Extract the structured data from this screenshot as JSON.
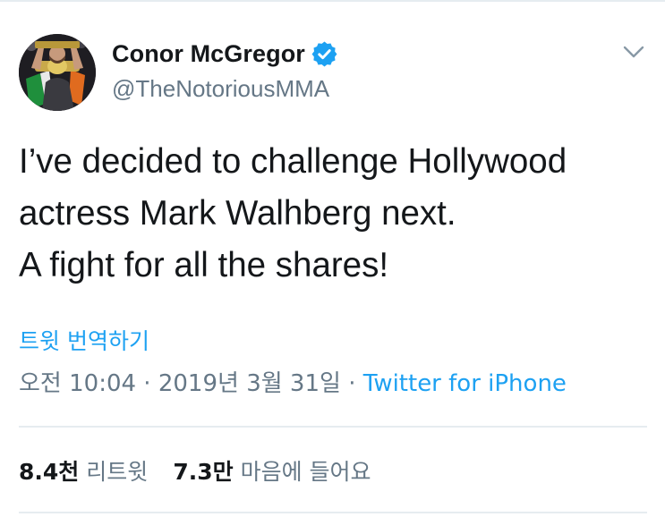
{
  "user": {
    "display_name": "Conor McGregor",
    "handle": "@TheNotoriousMMA",
    "verified": true,
    "verified_color": "#1da1f2"
  },
  "tweet": {
    "text": "I’ve decided to challenge Hollywood\nactress Mark Walhberg next.\nA fight for all the shares!",
    "translate_label": "트윗 번역하기"
  },
  "meta": {
    "time": "오전 10:04",
    "separator": " · ",
    "date": "2019년 3월 31일",
    "source": "Twitter for iPhone"
  },
  "stats": {
    "retweets_count": "8.4천",
    "retweets_label": "리트윗",
    "likes_count": "7.3만",
    "likes_label": "마음에 들어요"
  },
  "icons": {
    "caret": "chevron-down-icon",
    "verified": "verified-badge-icon"
  },
  "colors": {
    "link": "#1da1f2",
    "secondary_text": "#657786",
    "primary_text": "#14171a",
    "divider": "#e6ecf0"
  }
}
